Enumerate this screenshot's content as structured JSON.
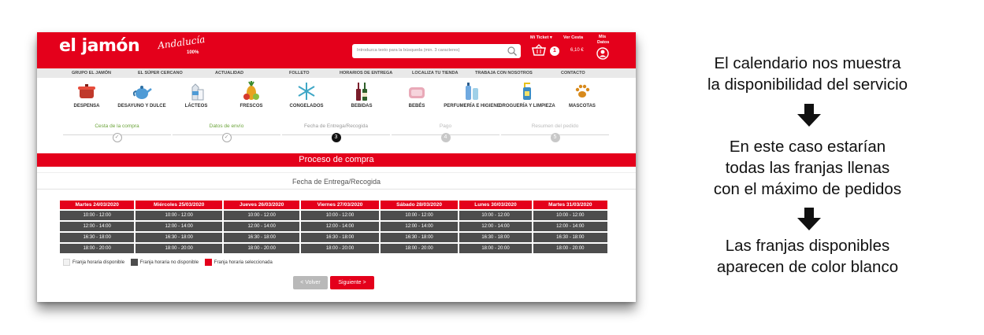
{
  "header": {
    "logo": "el jamón",
    "logo_sub": "Andalucía",
    "logo_sub_badge": "100%",
    "search_placeholder": "Introduzca texto para la búsqueda (min. 3 caracteres)",
    "my_ticket": "Mi Ticket ▾",
    "view_cart": "Ver Cesta",
    "my_data_1": "Mis",
    "my_data_2": "Datos",
    "cart_count": "1",
    "cart_total": "6,10 €"
  },
  "topnav": [
    "GRUPO EL JAMÓN",
    "EL SÚPER CERCANO",
    "ACTUALIDAD",
    "FOLLETO",
    "HORARIOS DE ENTREGA",
    "LOCALIZA TU TIENDA",
    "TRABAJA CON NOSOTROS",
    "CONTACTO"
  ],
  "categories": [
    {
      "label": "DESPENSA",
      "icon": "pot-icon",
      "color": "#c0392b"
    },
    {
      "label": "DESAYUNO Y DULCE",
      "icon": "teapot-icon",
      "color": "#4f9bd6"
    },
    {
      "label": "LÁCTEOS",
      "icon": "milk-icon",
      "color": "#c9d3df"
    },
    {
      "label": "FRESCOS",
      "icon": "fruit-icon",
      "color": "#e8a321"
    },
    {
      "label": "CONGELADOS",
      "icon": "snowflake-icon",
      "color": "#3fa7c6"
    },
    {
      "label": "BEBIDAS",
      "icon": "bottles-icon",
      "color": "#7a1d2b"
    },
    {
      "label": "BEBÉS",
      "icon": "baby-icon",
      "color": "#e9a9b8"
    },
    {
      "label": "PERFUMERÍA E HIGIENE",
      "icon": "perfume-icon",
      "color": "#6fa9e0"
    },
    {
      "label": "DROGUERÍA Y LIMPIEZA",
      "icon": "cleaning-icon",
      "color": "#3a8cc4"
    },
    {
      "label": "MASCOTAS",
      "icon": "paw-icon",
      "color": "#d88a1c"
    }
  ],
  "steps": [
    {
      "label": "Cesta de la compra",
      "mark": "✓",
      "state": "done"
    },
    {
      "label": "Datos de envío",
      "mark": "✓",
      "state": "done"
    },
    {
      "label": "Fecha de Entrega/Recogida",
      "mark": "3",
      "state": "current"
    },
    {
      "label": "Pago",
      "mark": "4",
      "state": "future"
    },
    {
      "label": "Resumen del pedido",
      "mark": "5",
      "state": "future"
    }
  ],
  "process_title": "Proceso de compra",
  "section_title": "Fecha de Entrega/Recogida",
  "schedule": {
    "days": [
      "Martes 24/03/2020",
      "Miércoles 25/03/2020",
      "Jueves 26/03/2020",
      "Viernes 27/03/2020",
      "Sábado 28/03/2020",
      "Lunes 30/03/2020",
      "Martes 31/03/2020"
    ],
    "slots": [
      "10:00 - 12:00",
      "12:00 - 14:00",
      "16:30 - 18:00",
      "18:00 - 20:00"
    ],
    "slot_status": "no disponible"
  },
  "legend": [
    {
      "label": "Franja horaria disponible",
      "color": "#f2f2f2"
    },
    {
      "label": "Franja horaria no disponible",
      "color": "#4d4d4d"
    },
    {
      "label": "Franja horaria seleccionada",
      "color": "#e4001b"
    }
  ],
  "buttons": {
    "back": "< Volver",
    "next": "Siguiente >"
  },
  "annotations": {
    "note1": [
      "El calendario nos muestra",
      "la disponibilidad del servicio"
    ],
    "note2": [
      "En este caso estarían",
      "todas las franjas llenas",
      "con el máximo de pedidos"
    ],
    "note3": [
      "Las franjas disponibles",
      "aparecen de color blanco"
    ]
  },
  "colors": {
    "brand": "#e4001b",
    "unavailable": "#4d4d4d",
    "done_step": "#6ba43a"
  }
}
